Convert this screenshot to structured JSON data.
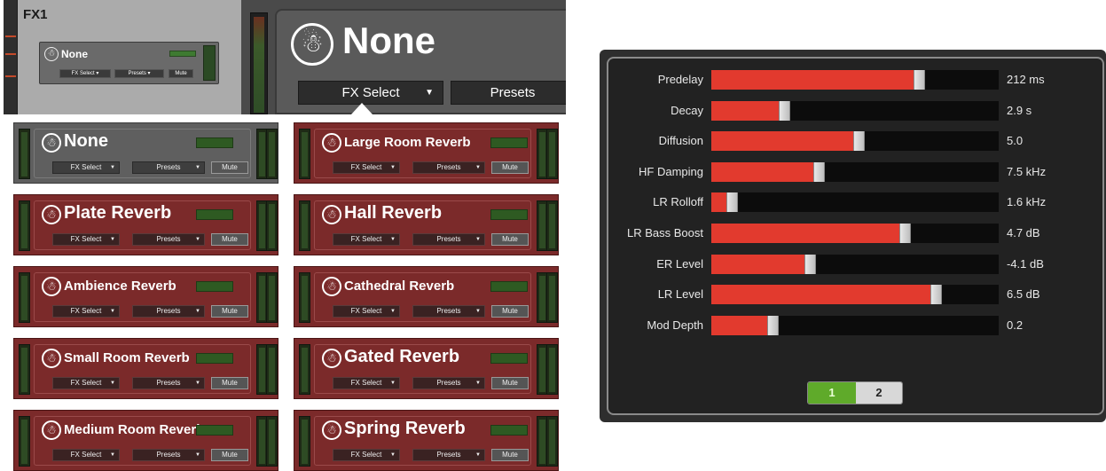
{
  "header": {
    "channel_label": "FX1",
    "current_fx_name": "None",
    "fx_select_label": "FX Select",
    "presets_label": "Presets",
    "mini_strip": {
      "name": "None",
      "fx_select_label": "FX Select",
      "presets_label": "Presets",
      "mute_label": "Mute"
    }
  },
  "tiles": [
    {
      "name": "None",
      "fx_select": "FX Select",
      "presets": "Presets",
      "mute": "Mute"
    },
    {
      "name": "Large Room Reverb",
      "fx_select": "FX Select",
      "presets": "Presets",
      "mute": "Mute"
    },
    {
      "name": "Plate Reverb",
      "fx_select": "FX Select",
      "presets": "Presets",
      "mute": "Mute"
    },
    {
      "name": "Hall Reverb",
      "fx_select": "FX Select",
      "presets": "Presets",
      "mute": "Mute"
    },
    {
      "name": "Ambience Reverb",
      "fx_select": "FX Select",
      "presets": "Presets",
      "mute": "Mute"
    },
    {
      "name": "Cathedral Reverb",
      "fx_select": "FX Select",
      "presets": "Presets",
      "mute": "Mute"
    },
    {
      "name": "Small Room Reverb",
      "fx_select": "FX Select",
      "presets": "Presets",
      "mute": "Mute"
    },
    {
      "name": "Gated Reverb",
      "fx_select": "FX Select",
      "presets": "Presets",
      "mute": "Mute"
    },
    {
      "name": "Medium Room Reverb",
      "fx_select": "FX Select",
      "presets": "Presets",
      "mute": "Mute"
    },
    {
      "name": "Spring Reverb",
      "fx_select": "FX Select",
      "presets": "Presets",
      "mute": "Mute"
    }
  ],
  "params": [
    {
      "label": "Predelay",
      "value": "212 ms",
      "level": 0.71
    },
    {
      "label": "Decay",
      "value": "2.9 s",
      "level": 0.24
    },
    {
      "label": "Diffusion",
      "value": "5.0",
      "level": 0.5
    },
    {
      "label": "HF Damping",
      "value": "7.5 kHz",
      "level": 0.36
    },
    {
      "label": "LR Rolloff",
      "value": "1.6 kHz",
      "level": 0.06
    },
    {
      "label": "LR Bass Boost",
      "value": "4.7 dB",
      "level": 0.66
    },
    {
      "label": "ER Level",
      "value": "-4.1 dB",
      "level": 0.33
    },
    {
      "label": "LR Level",
      "value": "6.5 dB",
      "level": 0.77
    },
    {
      "label": "Mod Depth",
      "value": "0.2",
      "level": 0.2
    }
  ],
  "pager": {
    "page1": "1",
    "page2": "2",
    "active": 1
  },
  "icons": {
    "logo": "running-man-logo-icon",
    "caret": "caret-down-icon"
  },
  "colors": {
    "tile_bg": "#7b2a2a",
    "slider_fill": "#e23a2e",
    "active_page": "#5faa2a"
  }
}
